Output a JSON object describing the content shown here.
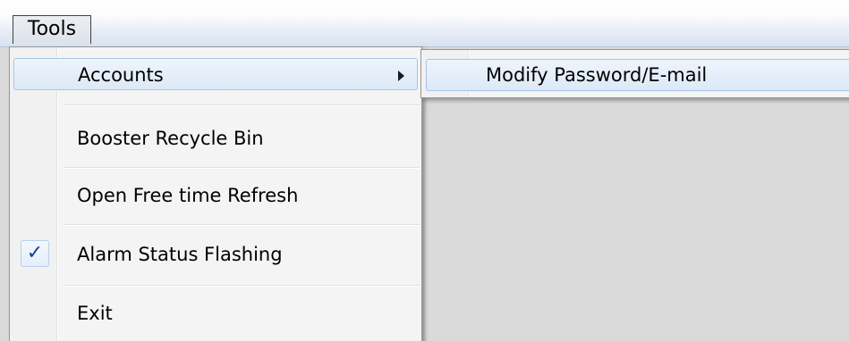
{
  "menubar": {
    "tools_label": "Tools"
  },
  "tools_menu": {
    "items": [
      {
        "label": "Accounts",
        "has_submenu": true
      },
      {
        "label": "Booster Recycle Bin"
      },
      {
        "label": "Open Free time Refresh"
      },
      {
        "label": "Alarm Status Flashing",
        "checked": true,
        "check_glyph": "✓"
      },
      {
        "label": "Exit"
      }
    ]
  },
  "accounts_submenu": {
    "items": [
      {
        "label": "Modify Password/E-mail"
      }
    ]
  },
  "colors": {
    "highlight_border": "#a8c4e6",
    "highlight_fill": "#dde9f7",
    "check_color": "#1b3f8f",
    "menu_background": "#f4f4f4",
    "desktop_background": "#dadada"
  },
  "icons": {
    "submenu_arrow": "triangle-right-icon",
    "check": "checkmark-icon"
  }
}
